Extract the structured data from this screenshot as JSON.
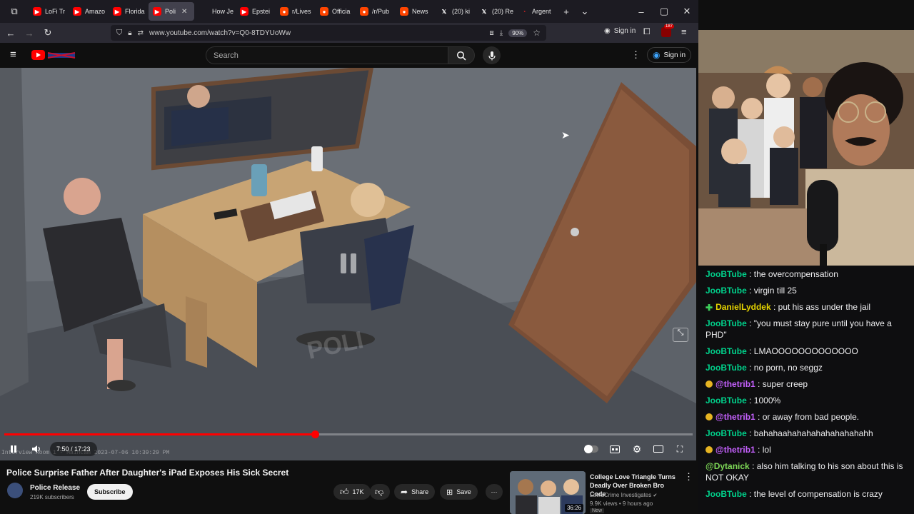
{
  "browser": {
    "tabs": [
      {
        "label": "LoFi Tr",
        "icon": "youtube-icon"
      },
      {
        "label": "Amazo",
        "icon": "youtube-icon"
      },
      {
        "label": "Florida",
        "icon": "youtube-icon"
      },
      {
        "label": "Poli",
        "icon": "youtube-icon",
        "active": true
      },
      {
        "label": "How Je",
        "icon": "generic-icon"
      },
      {
        "label": "Epstei",
        "icon": "youtube-icon"
      },
      {
        "label": "r/Lives",
        "icon": "reddit-icon"
      },
      {
        "label": "Officia",
        "icon": "reddit-icon"
      },
      {
        "label": "/r/Pub",
        "icon": "reddit-icon"
      },
      {
        "label": "News",
        "icon": "reddit-icon"
      },
      {
        "label": "(20) ki",
        "icon": "x-icon"
      },
      {
        "label": "(20) Re",
        "icon": "x-icon"
      },
      {
        "label": "Argent",
        "icon": "circle-icon"
      }
    ],
    "url": "www.youtube.com/watch?v=Q0-8TDYUoWw",
    "zoom": "90%",
    "signin": "Sign in",
    "ext_badge": "187"
  },
  "youtube": {
    "search_placeholder": "Search",
    "signin": "Sign in"
  },
  "player": {
    "current_time": "7:50",
    "duration": "17:23",
    "time_display": "7:50 / 17:23",
    "progress_fraction": 0.451,
    "overlay_text": "Interview Room 1 - MainCam 2023-07-06 10:39:29 PM",
    "watermark": "POLI"
  },
  "video": {
    "title": "Police Surprise Father After Daughter's iPad Exposes His Sick Secret",
    "channel": "Police Release",
    "subscribers": "219K subscribers",
    "subscribe_label": "Subscribe",
    "likes": "17K",
    "share_label": "Share",
    "save_label": "Save"
  },
  "recommendation": {
    "title": "College Love Triangle Turns Deadly Over Broken Bro Code",
    "channel": "Law&Crime Investigates",
    "meta": "9.9K views • 9 hours ago",
    "badge": "New",
    "duration": "36:26"
  },
  "chat": [
    {
      "user": "JooBTube",
      "text": "the overcompensation",
      "color": "#00d18b",
      "badge": null
    },
    {
      "user": "JooBTube",
      "text": "virgin till 25",
      "color": "#00d18b",
      "badge": null
    },
    {
      "user": "DanielLyddek",
      "text": "put his ass under the jail",
      "color": "#e6d400",
      "badge": "plus"
    },
    {
      "user": "JooBTube",
      "text": "\"you must stay pure until you have a PHD\"",
      "color": "#00d18b",
      "badge": null
    },
    {
      "user": "JooBTube",
      "text": "LMAOOOOOOOOOOOOO",
      "color": "#00d18b",
      "badge": null
    },
    {
      "user": "JooBTube",
      "text": "no porn, no seggz",
      "color": "#00d18b",
      "badge": null
    },
    {
      "user": "@thetrib1",
      "text": "super creep",
      "color": "#c661ff",
      "badge": "sub"
    },
    {
      "user": "JooBTube",
      "text": "1000%",
      "color": "#00d18b",
      "badge": null
    },
    {
      "user": "@thetrib1",
      "text": "or away from bad people.",
      "color": "#c661ff",
      "badge": "sub"
    },
    {
      "user": "JooBTube",
      "text": "bahahaahahahahahahahahahh",
      "color": "#00d18b",
      "badge": null
    },
    {
      "user": "@thetrib1",
      "text": "lol",
      "color": "#c661ff",
      "badge": "sub"
    },
    {
      "user": "@Dytanick",
      "text": "also him talking to his son about this is NOT OKAY",
      "color": "#7ed957",
      "badge": null
    },
    {
      "user": "JooBTube",
      "text": "the level of compensation is crazy",
      "color": "#00d18b",
      "badge": null
    }
  ]
}
